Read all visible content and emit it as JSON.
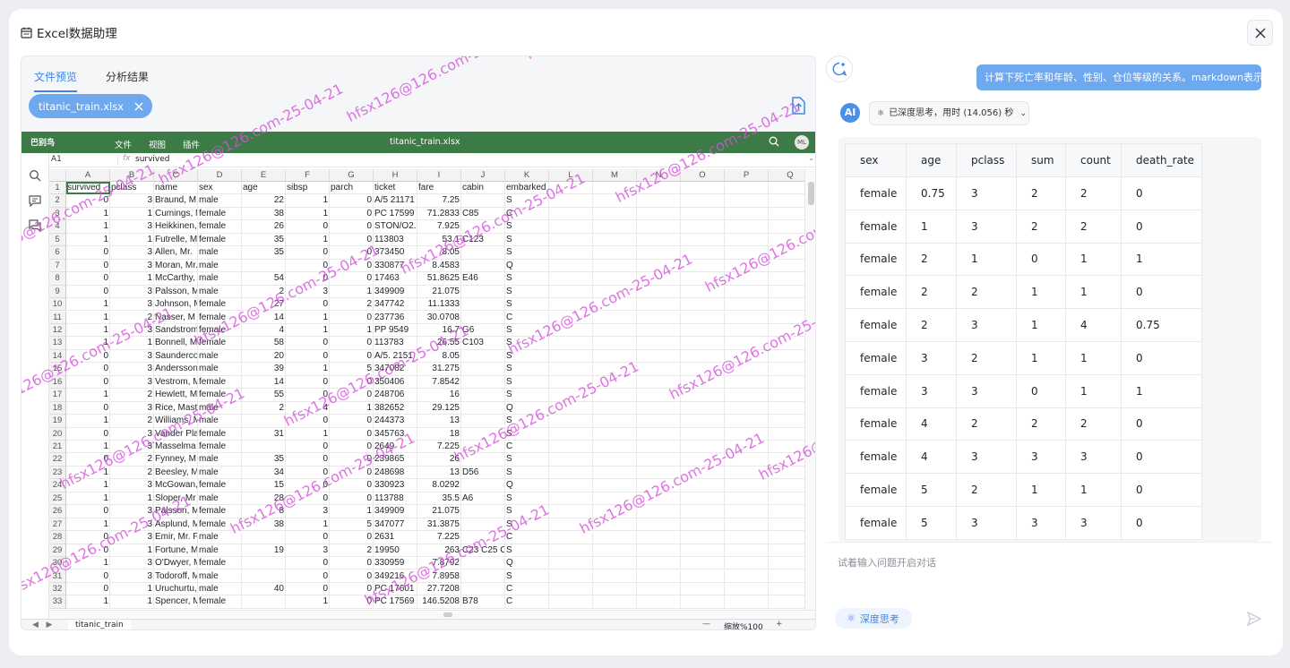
{
  "window": {
    "title": "Excel数据助理"
  },
  "tabs": [
    {
      "label": "文件预览",
      "active": true
    },
    {
      "label": "分析结果",
      "active": false
    }
  ],
  "file_chip": {
    "name": "titanic_train.xlsx"
  },
  "spreadsheet": {
    "app_name": "巴别鸟",
    "menu": [
      "文件",
      "视图",
      "插件"
    ],
    "file_title": "titanic_train.xlsx",
    "avatar": "ML",
    "cell_ref": "A1",
    "fx": "fx",
    "formula_value": "survived",
    "columns": [
      "A",
      "B",
      "C",
      "D",
      "E",
      "F",
      "G",
      "H",
      "I",
      "J",
      "K",
      "L",
      "M",
      "N",
      "O",
      "P",
      "Q"
    ],
    "header_row": [
      "survived",
      "pclass",
      "name",
      "sex",
      "age",
      "sibsp",
      "parch",
      "ticket",
      "fare",
      "cabin",
      "embarked"
    ],
    "rows": [
      [
        "0",
        "3",
        "Braund, M",
        "male",
        "22",
        "1",
        "0",
        "A/5 21171",
        "7.25",
        "",
        "S"
      ],
      [
        "1",
        "1",
        "Cumings, M",
        "female",
        "38",
        "1",
        "0",
        "PC 17599",
        "71.2833",
        "C85",
        "C"
      ],
      [
        "1",
        "3",
        "Heikkinen,",
        "female",
        "26",
        "0",
        "0",
        "STON/O2.",
        "7.925",
        "",
        "S"
      ],
      [
        "1",
        "1",
        "Futrelle, M",
        "female",
        "35",
        "1",
        "0",
        "113803",
        "53.1",
        "C123",
        "S"
      ],
      [
        "0",
        "3",
        "Allen, Mr.",
        "male",
        "35",
        "0",
        "0",
        "373450",
        "8.05",
        "",
        "S"
      ],
      [
        "0",
        "3",
        "Moran, Mr.",
        "male",
        "",
        "0",
        "0",
        "330877",
        "8.4583",
        "",
        "Q"
      ],
      [
        "0",
        "1",
        "McCarthy,",
        "male",
        "54",
        "0",
        "0",
        "17463",
        "51.8625",
        "E46",
        "S"
      ],
      [
        "0",
        "3",
        "Palsson, M",
        "male",
        "2",
        "3",
        "1",
        "349909",
        "21.075",
        "",
        "S"
      ],
      [
        "1",
        "3",
        "Johnson, M",
        "female",
        "27",
        "0",
        "2",
        "347742",
        "11.1333",
        "",
        "S"
      ],
      [
        "1",
        "2",
        "Nasser, M",
        "female",
        "14",
        "1",
        "0",
        "237736",
        "30.0708",
        "",
        "C"
      ],
      [
        "1",
        "3",
        "Sandstrom",
        "female",
        "4",
        "1",
        "1",
        "PP 9549",
        "16.7",
        "G6",
        "S"
      ],
      [
        "1",
        "1",
        "Bonnell, M",
        "female",
        "58",
        "0",
        "0",
        "113783",
        "26.55",
        "C103",
        "S"
      ],
      [
        "0",
        "3",
        "Saunderco",
        "male",
        "20",
        "0",
        "0",
        "A/5. 2151",
        "8.05",
        "",
        "S"
      ],
      [
        "0",
        "3",
        "Andersson",
        "male",
        "39",
        "1",
        "5",
        "347082",
        "31.275",
        "",
        "S"
      ],
      [
        "0",
        "3",
        "Vestrom, M",
        "female",
        "14",
        "0",
        "0",
        "350406",
        "7.8542",
        "",
        "S"
      ],
      [
        "1",
        "2",
        "Hewlett, M",
        "female",
        "55",
        "0",
        "0",
        "248706",
        "16",
        "",
        "S"
      ],
      [
        "0",
        "3",
        "Rice, Mast",
        "male",
        "2",
        "4",
        "1",
        "382652",
        "29.125",
        "",
        "Q"
      ],
      [
        "1",
        "2",
        "Williams, M",
        "male",
        "",
        "0",
        "0",
        "244373",
        "13",
        "",
        "S"
      ],
      [
        "0",
        "3",
        "Vander Pla",
        "female",
        "31",
        "1",
        "0",
        "345763",
        "18",
        "",
        "S"
      ],
      [
        "1",
        "3",
        "Masselma",
        "female",
        "",
        "0",
        "0",
        "2649",
        "7.225",
        "",
        "C"
      ],
      [
        "0",
        "2",
        "Fynney, M",
        "male",
        "35",
        "0",
        "0",
        "239865",
        "26",
        "",
        "S"
      ],
      [
        "1",
        "2",
        "Beesley, M",
        "male",
        "34",
        "0",
        "0",
        "248698",
        "13",
        "D56",
        "S"
      ],
      [
        "1",
        "3",
        "McGowan,",
        "female",
        "15",
        "0",
        "0",
        "330923",
        "8.0292",
        "",
        "Q"
      ],
      [
        "1",
        "1",
        "Sloper, Mr",
        "male",
        "28",
        "0",
        "0",
        "113788",
        "35.5",
        "A6",
        "S"
      ],
      [
        "0",
        "3",
        "Palsson, M",
        "female",
        "8",
        "3",
        "1",
        "349909",
        "21.075",
        "",
        "S"
      ],
      [
        "1",
        "3",
        "Asplund, M",
        "female",
        "38",
        "1",
        "5",
        "347077",
        "31.3875",
        "",
        "S"
      ],
      [
        "0",
        "3",
        "Emir, Mr. F",
        "male",
        "",
        "0",
        "0",
        "2631",
        "7.225",
        "",
        "C"
      ],
      [
        "0",
        "1",
        "Fortune, M",
        "male",
        "19",
        "3",
        "2",
        "19950",
        "263",
        "C23 C25 C",
        "S"
      ],
      [
        "1",
        "3",
        "O'Dwyer, M",
        "female",
        "",
        "0",
        "0",
        "330959",
        "7.8792",
        "",
        "Q"
      ],
      [
        "0",
        "3",
        "Todoroff, M",
        "male",
        "",
        "0",
        "0",
        "349216",
        "7.8958",
        "",
        "S"
      ],
      [
        "0",
        "1",
        "Uruchurtu,",
        "male",
        "40",
        "0",
        "0",
        "PC 17601",
        "27.7208",
        "",
        "C"
      ],
      [
        "1",
        "1",
        "Spencer, M",
        "female",
        "",
        "1",
        "0",
        "PC 17569",
        "146.5208",
        "B78",
        "C"
      ]
    ],
    "sheet_tab": "titanic_train",
    "zoom_label": "缩放%100",
    "zoom_minus": "—",
    "zoom_plus": "+"
  },
  "watermark_text": "hfsx126@126.com-25-04-21",
  "chat": {
    "user_message": "计算下死亡率和年龄、性别、仓位等级的关系。markdown表示",
    "ai_badge": "AI",
    "thinking_label": "已深度思考，用时 (14.056) 秒",
    "table_headers": [
      "sex",
      "age",
      "pclass",
      "sum",
      "count",
      "death_rate"
    ],
    "table_rows": [
      [
        "female",
        "0.75",
        "3",
        "2",
        "2",
        "0"
      ],
      [
        "female",
        "1",
        "3",
        "2",
        "2",
        "0"
      ],
      [
        "female",
        "2",
        "1",
        "0",
        "1",
        "1"
      ],
      [
        "female",
        "2",
        "2",
        "1",
        "1",
        "0"
      ],
      [
        "female",
        "2",
        "3",
        "1",
        "4",
        "0.75"
      ],
      [
        "female",
        "3",
        "2",
        "1",
        "1",
        "0"
      ],
      [
        "female",
        "3",
        "3",
        "0",
        "1",
        "1"
      ],
      [
        "female",
        "4",
        "2",
        "2",
        "2",
        "0"
      ],
      [
        "female",
        "4",
        "3",
        "3",
        "3",
        "0"
      ],
      [
        "female",
        "5",
        "2",
        "1",
        "1",
        "0"
      ],
      [
        "female",
        "5",
        "3",
        "3",
        "3",
        "0"
      ]
    ],
    "input_placeholder": "试着输入问题开启对话",
    "deep_think_label": "深度思考"
  },
  "colors": {
    "accent": "#6ea9ef",
    "wps_green": "#3c7a46",
    "watermark": "#d750dc"
  }
}
